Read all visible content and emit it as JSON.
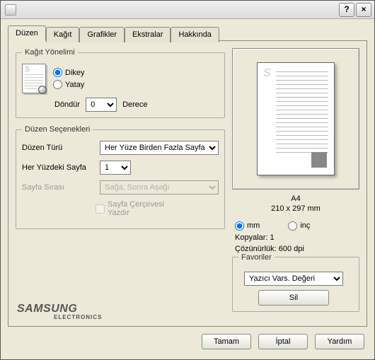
{
  "titlebar": {
    "title": " ",
    "help": "?",
    "close": "×"
  },
  "tabs": [
    {
      "label": "Düzen"
    },
    {
      "label": "Kağıt"
    },
    {
      "label": "Grafikler"
    },
    {
      "label": "Ekstralar"
    },
    {
      "label": "Hakkında"
    }
  ],
  "orientation": {
    "legend": "Kağıt Yönelimi",
    "portrait": "Dikey",
    "landscape": "Yatay",
    "rotate_label": "Döndür",
    "rotate_value": "0",
    "rotate_unit": "Derece"
  },
  "layoutopts": {
    "legend": "Düzen Seçenekleri",
    "type_label": "Düzen Türü",
    "type_value": "Her Yüze Birden Fazla Sayfa",
    "pps_label": "Her Yüzdeki Sayfa",
    "pps_value": "1",
    "order_label": "Sayfa Sırası",
    "order_value": "Sağa, Sonra Aşağı",
    "border_label": "Sayfa Çerçevesi Yazdır"
  },
  "preview": {
    "size_name": "A4",
    "size_dim": "210 x 297 mm"
  },
  "units": {
    "mm": "mm",
    "inch": "inç"
  },
  "info": {
    "copies": "Kopyalar: 1",
    "resolution": "Çözünürlük: 600 dpi"
  },
  "favorites": {
    "legend": "Favoriler",
    "selected": "Yazıcı Vars. Değeri",
    "delete": "Sil"
  },
  "logo": {
    "brand": "SAMSUNG",
    "sub": "ELECTRONICS"
  },
  "buttons": {
    "ok": "Tamam",
    "cancel": "İptal",
    "help": "Yardım"
  }
}
